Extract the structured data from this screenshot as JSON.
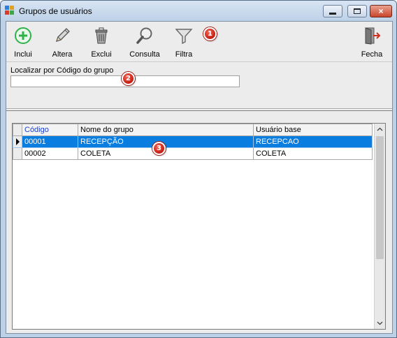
{
  "window": {
    "title": "Grupos de usuários",
    "icon": "app-icon",
    "controls": {
      "minimize": "minimize-icon",
      "maximize": "maximize-icon",
      "close": "×"
    }
  },
  "toolbar": {
    "items": [
      {
        "label": "Inclui",
        "icon": "plus-circle-icon"
      },
      {
        "label": "Altera",
        "icon": "pencil-icon"
      },
      {
        "label": "Exclui",
        "icon": "trash-icon"
      },
      {
        "label": "Consulta",
        "icon": "magnifier-icon"
      },
      {
        "label": "Filtra",
        "icon": "funnel-icon"
      },
      {
        "label": "Fecha",
        "icon": "exit-door-icon"
      }
    ]
  },
  "search": {
    "label": "Localizar por Código do grupo",
    "value": ""
  },
  "grid": {
    "columns": [
      "Código",
      "Nome do grupo",
      "Usuário base"
    ],
    "rows": [
      {
        "codigo": "00001",
        "nome": "RECEPÇÃO",
        "usuario_base": "RECEPCAO",
        "selected": true
      },
      {
        "codigo": "00002",
        "nome": "COLETA",
        "usuario_base": "COLETA",
        "selected": false
      }
    ]
  },
  "callouts": [
    "1",
    "2",
    "3"
  ],
  "colors": {
    "selection": "#0a7de0",
    "sorted_header": "#1a3fd0",
    "callout": "#c41b10"
  }
}
